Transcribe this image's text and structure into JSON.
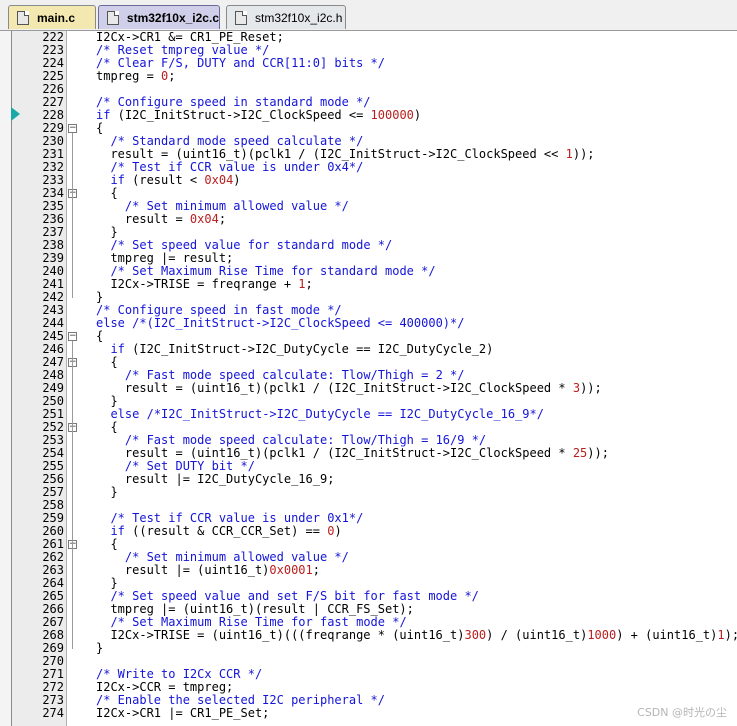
{
  "tabs": [
    {
      "label": "main.c"
    },
    {
      "label": "stm32f10x_i2c.c"
    },
    {
      "label": "stm32f10x_i2c.h"
    }
  ],
  "watermark": "CSDN @时光の尘",
  "lines": [
    {
      "n": "222",
      "f": "",
      "seg": [
        [
          "t",
          "I2Cx->CR1 &= CR1_PE_Reset;"
        ]
      ]
    },
    {
      "n": "223",
      "f": "",
      "seg": [
        [
          "c",
          "/* Reset tmpreg value */"
        ]
      ]
    },
    {
      "n": "224",
      "f": "",
      "seg": [
        [
          "c",
          "/* Clear F/S, DUTY and CCR[11:0] bits */"
        ]
      ]
    },
    {
      "n": "225",
      "f": "",
      "seg": [
        [
          "t",
          "tmpreg = "
        ],
        [
          "n",
          "0"
        ],
        [
          "t",
          ";"
        ]
      ]
    },
    {
      "n": "226",
      "f": "",
      "seg": []
    },
    {
      "n": "227",
      "f": "",
      "seg": [
        [
          "c",
          "/* Configure speed in standard mode */"
        ]
      ]
    },
    {
      "n": "228",
      "f": "",
      "seg": [
        [
          "k",
          "if"
        ],
        [
          "t",
          " (I2C_InitStruct->I2C_ClockSpeed <= "
        ],
        [
          "n",
          "100000"
        ],
        [
          "t",
          ")"
        ]
      ]
    },
    {
      "n": "229",
      "f": "-",
      "seg": [
        [
          "t",
          "{"
        ]
      ]
    },
    {
      "n": "230",
      "f": "",
      "seg": [
        [
          "t",
          "  "
        ],
        [
          "c",
          "/* Standard mode speed calculate */"
        ]
      ]
    },
    {
      "n": "231",
      "f": "",
      "seg": [
        [
          "t",
          "  result = (uint16_t)(pclk1 / (I2C_InitStruct->I2C_ClockSpeed << "
        ],
        [
          "n",
          "1"
        ],
        [
          "t",
          "));"
        ]
      ]
    },
    {
      "n": "232",
      "f": "",
      "seg": [
        [
          "t",
          "  "
        ],
        [
          "c",
          "/* Test if CCR value is under 0x4*/"
        ]
      ]
    },
    {
      "n": "233",
      "f": "",
      "seg": [
        [
          "t",
          "  "
        ],
        [
          "k",
          "if"
        ],
        [
          "t",
          " (result < "
        ],
        [
          "n",
          "0x04"
        ],
        [
          "t",
          ")"
        ]
      ]
    },
    {
      "n": "234",
      "f": "-",
      "seg": [
        [
          "t",
          "  {"
        ]
      ]
    },
    {
      "n": "235",
      "f": "",
      "seg": [
        [
          "t",
          "    "
        ],
        [
          "c",
          "/* Set minimum allowed value */"
        ]
      ]
    },
    {
      "n": "236",
      "f": "",
      "seg": [
        [
          "t",
          "    result = "
        ],
        [
          "n",
          "0x04"
        ],
        [
          "t",
          ";"
        ]
      ]
    },
    {
      "n": "237",
      "f": "",
      "seg": [
        [
          "t",
          "  }"
        ]
      ]
    },
    {
      "n": "238",
      "f": "",
      "seg": [
        [
          "t",
          "  "
        ],
        [
          "c",
          "/* Set speed value for standard mode */"
        ]
      ]
    },
    {
      "n": "239",
      "f": "",
      "seg": [
        [
          "t",
          "  tmpreg |= result;"
        ]
      ]
    },
    {
      "n": "240",
      "f": "",
      "seg": [
        [
          "t",
          "  "
        ],
        [
          "c",
          "/* Set Maximum Rise Time for standard mode */"
        ]
      ]
    },
    {
      "n": "241",
      "f": "",
      "seg": [
        [
          "t",
          "  I2Cx->TRISE = freqrange + "
        ],
        [
          "n",
          "1"
        ],
        [
          "t",
          ";"
        ]
      ]
    },
    {
      "n": "242",
      "f": "",
      "seg": [
        [
          "t",
          "}"
        ]
      ]
    },
    {
      "n": "243",
      "f": "",
      "seg": [
        [
          "c",
          "/* Configure speed in fast mode */"
        ]
      ]
    },
    {
      "n": "244",
      "f": "",
      "seg": [
        [
          "k",
          "else"
        ],
        [
          "t",
          " "
        ],
        [
          "c",
          "/*(I2C_InitStruct->I2C_ClockSpeed <= 400000)*/"
        ]
      ]
    },
    {
      "n": "245",
      "f": "-",
      "seg": [
        [
          "t",
          "{"
        ]
      ]
    },
    {
      "n": "246",
      "f": "",
      "seg": [
        [
          "t",
          "  "
        ],
        [
          "k",
          "if"
        ],
        [
          "t",
          " (I2C_InitStruct->I2C_DutyCycle == I2C_DutyCycle_2)"
        ]
      ]
    },
    {
      "n": "247",
      "f": "-",
      "seg": [
        [
          "t",
          "  {"
        ]
      ]
    },
    {
      "n": "248",
      "f": "",
      "seg": [
        [
          "t",
          "    "
        ],
        [
          "c",
          "/* Fast mode speed calculate: Tlow/Thigh = 2 */"
        ]
      ]
    },
    {
      "n": "249",
      "f": "",
      "seg": [
        [
          "t",
          "    result = (uint16_t)(pclk1 / (I2C_InitStruct->I2C_ClockSpeed * "
        ],
        [
          "n",
          "3"
        ],
        [
          "t",
          "));"
        ]
      ]
    },
    {
      "n": "250",
      "f": "",
      "seg": [
        [
          "t",
          "  }"
        ]
      ]
    },
    {
      "n": "251",
      "f": "",
      "seg": [
        [
          "t",
          "  "
        ],
        [
          "k",
          "else"
        ],
        [
          "t",
          " "
        ],
        [
          "c",
          "/*I2C_InitStruct->I2C_DutyCycle == I2C_DutyCycle_16_9*/"
        ]
      ]
    },
    {
      "n": "252",
      "f": "-",
      "seg": [
        [
          "t",
          "  {"
        ]
      ]
    },
    {
      "n": "253",
      "f": "",
      "seg": [
        [
          "t",
          "    "
        ],
        [
          "c",
          "/* Fast mode speed calculate: Tlow/Thigh = 16/9 */"
        ]
      ]
    },
    {
      "n": "254",
      "f": "",
      "seg": [
        [
          "t",
          "    result = (uint16_t)(pclk1 / (I2C_InitStruct->I2C_ClockSpeed * "
        ],
        [
          "n",
          "25"
        ],
        [
          "t",
          "));"
        ]
      ]
    },
    {
      "n": "255",
      "f": "",
      "seg": [
        [
          "t",
          "    "
        ],
        [
          "c",
          "/* Set DUTY bit */"
        ]
      ]
    },
    {
      "n": "256",
      "f": "",
      "seg": [
        [
          "t",
          "    result |= I2C_DutyCycle_16_9;"
        ]
      ]
    },
    {
      "n": "257",
      "f": "",
      "seg": [
        [
          "t",
          "  }"
        ]
      ]
    },
    {
      "n": "258",
      "f": "",
      "seg": []
    },
    {
      "n": "259",
      "f": "",
      "seg": [
        [
          "t",
          "  "
        ],
        [
          "c",
          "/* Test if CCR value is under 0x1*/"
        ]
      ]
    },
    {
      "n": "260",
      "f": "",
      "seg": [
        [
          "t",
          "  "
        ],
        [
          "k",
          "if"
        ],
        [
          "t",
          " ((result & CCR_CCR_Set) == "
        ],
        [
          "n",
          "0"
        ],
        [
          "t",
          ")"
        ]
      ]
    },
    {
      "n": "261",
      "f": "-",
      "seg": [
        [
          "t",
          "  {"
        ]
      ]
    },
    {
      "n": "262",
      "f": "",
      "seg": [
        [
          "t",
          "    "
        ],
        [
          "c",
          "/* Set minimum allowed value */"
        ]
      ]
    },
    {
      "n": "263",
      "f": "",
      "seg": [
        [
          "t",
          "    result |= (uint16_t)"
        ],
        [
          "n",
          "0x0001"
        ],
        [
          "t",
          ";"
        ]
      ]
    },
    {
      "n": "264",
      "f": "",
      "seg": [
        [
          "t",
          "  }"
        ]
      ]
    },
    {
      "n": "265",
      "f": "",
      "seg": [
        [
          "t",
          "  "
        ],
        [
          "c",
          "/* Set speed value and set F/S bit for fast mode */"
        ]
      ]
    },
    {
      "n": "266",
      "f": "",
      "seg": [
        [
          "t",
          "  tmpreg |= (uint16_t)(result | CCR_FS_Set);"
        ]
      ]
    },
    {
      "n": "267",
      "f": "",
      "seg": [
        [
          "t",
          "  "
        ],
        [
          "c",
          "/* Set Maximum Rise Time for fast mode */"
        ]
      ]
    },
    {
      "n": "268",
      "f": "",
      "seg": [
        [
          "t",
          "  I2Cx->TRISE = (uint16_t)(((freqrange * (uint16_t)"
        ],
        [
          "n",
          "300"
        ],
        [
          "t",
          ") / (uint16_t)"
        ],
        [
          "n",
          "1000"
        ],
        [
          "t",
          ") + (uint16_t)"
        ],
        [
          "n",
          "1"
        ],
        [
          "t",
          ");"
        ]
      ]
    },
    {
      "n": "269",
      "f": "",
      "seg": [
        [
          "t",
          "}"
        ]
      ]
    },
    {
      "n": "270",
      "f": "",
      "seg": []
    },
    {
      "n": "271",
      "f": "",
      "seg": [
        [
          "c",
          "/* Write to I2Cx CCR */"
        ]
      ]
    },
    {
      "n": "272",
      "f": "",
      "seg": [
        [
          "t",
          "I2Cx->CCR = tmpreg;"
        ]
      ]
    },
    {
      "n": "273",
      "f": "",
      "seg": [
        [
          "c",
          "/* Enable the selected I2C peripheral */"
        ]
      ]
    },
    {
      "n": "274",
      "f": "",
      "seg": [
        [
          "t",
          "I2Cx->CR1 |= CR1_PE_Set;"
        ]
      ]
    }
  ]
}
